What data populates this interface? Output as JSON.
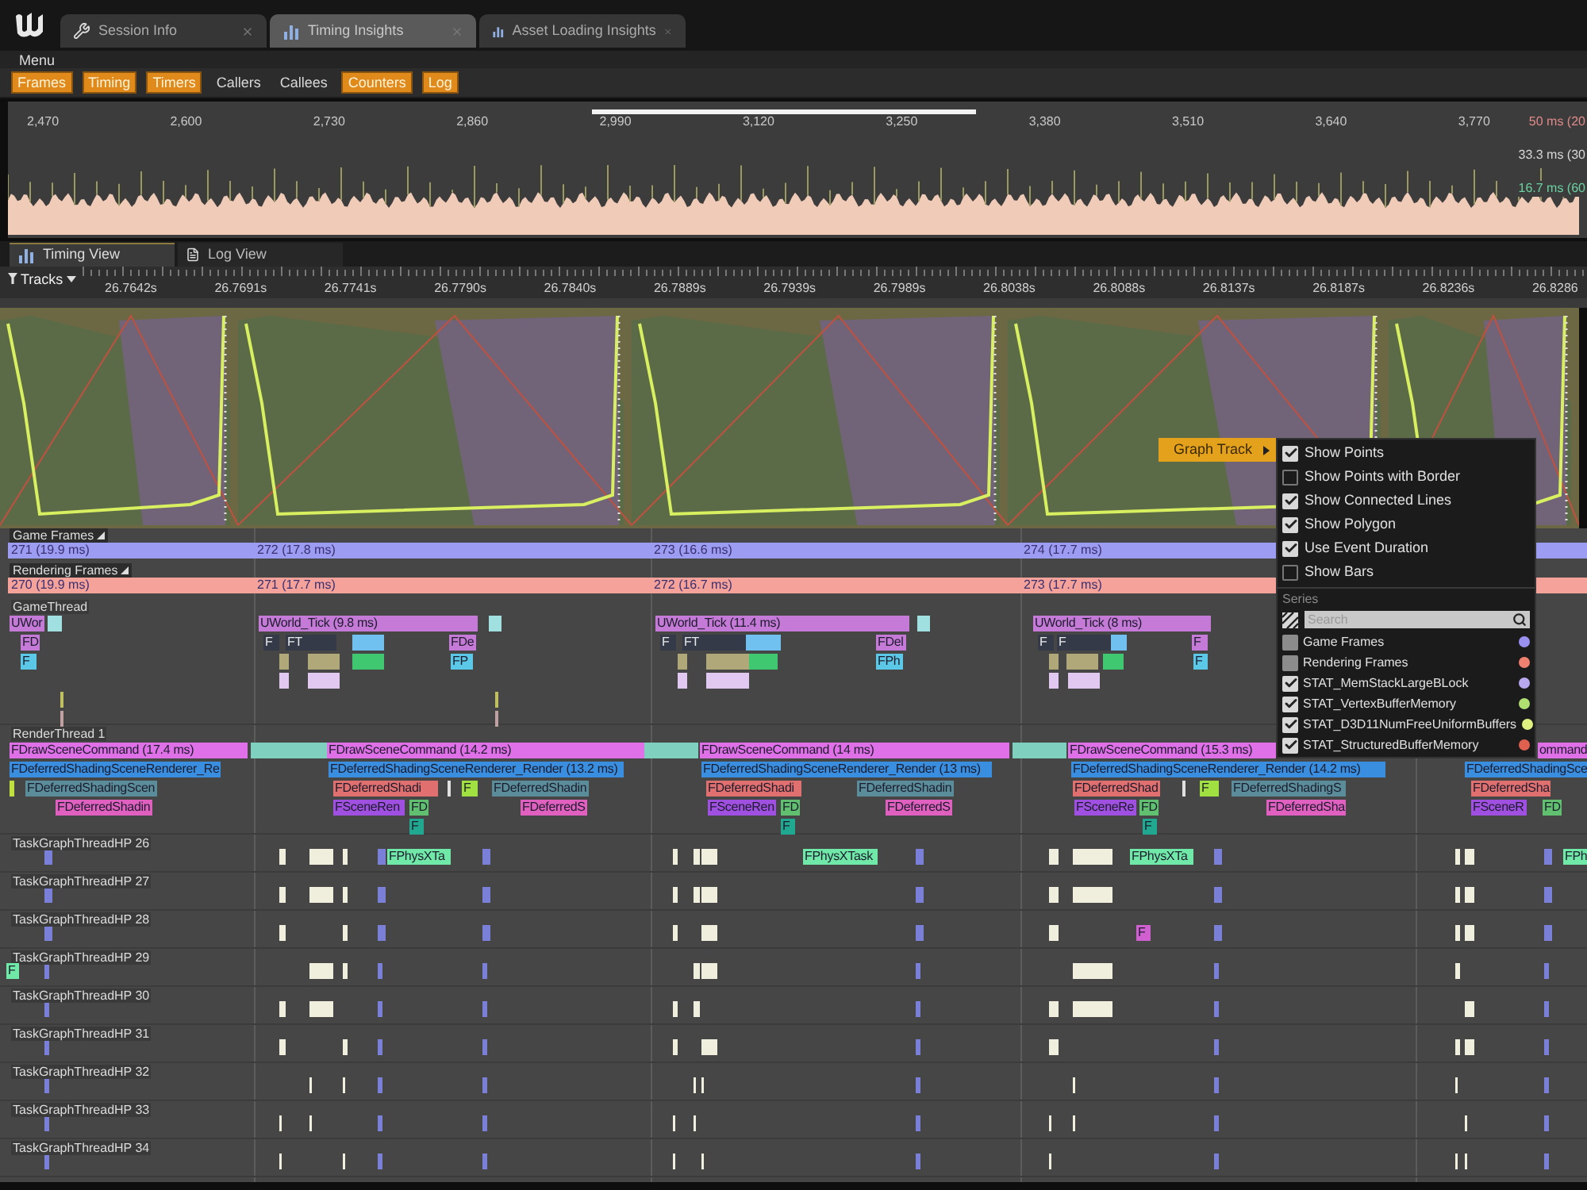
{
  "app_tabs": [
    {
      "label": "Session Info",
      "selected": false
    },
    {
      "label": "Timing Insights",
      "selected": true
    },
    {
      "label": "Asset Loading Insights",
      "selected": false
    }
  ],
  "menu_bar": [
    "Menu"
  ],
  "toolbar": [
    {
      "label": "Frames",
      "on": true
    },
    {
      "label": "Timing",
      "on": true
    },
    {
      "label": "Timers",
      "on": true
    },
    {
      "label": "Callers",
      "on": false
    },
    {
      "label": "Callees",
      "on": false
    },
    {
      "label": "Counters",
      "on": true
    },
    {
      "label": "Log",
      "on": true
    }
  ],
  "frames_panel": {
    "xticks": [
      "2,470",
      "2,600",
      "2,730",
      "2,860",
      "2,990",
      "3,120",
      "3,250",
      "3,380",
      "3,510",
      "3,640",
      "3,770"
    ],
    "thresholds": [
      {
        "label": "50 ms (20",
        "color": "#e08a8a"
      },
      {
        "label": "33.3 ms (30",
        "color": "#d8d8d8"
      },
      {
        "label": "16.7 ms (60",
        "color": "#6ad0a0"
      }
    ]
  },
  "view_tabs": [
    {
      "label": "Timing View",
      "selected": true
    },
    {
      "label": "Log View",
      "selected": false
    }
  ],
  "tracks_button": "Tracks",
  "time_ruler": [
    "26.7642s",
    "26.7691s",
    "26.7741s",
    "26.7790s",
    "26.7840s",
    "26.7889s",
    "26.7939s",
    "26.7989s",
    "26.8038s",
    "26.8088s",
    "26.8137s",
    "26.8187s",
    "26.8236s",
    "26.8286"
  ],
  "frame_tracks": [
    {
      "name": "Game Frames",
      "color": "#9c9cf2",
      "frames": [
        "271 (19.9 ms)",
        "272 (17.8 ms)",
        "273 (16.6 ms)",
        "274 (17.7 ms)"
      ]
    },
    {
      "name": "Rendering Frames",
      "color": "#f4a29a",
      "frames": [
        "270 (19.9 ms)",
        "271 (17.7 ms)",
        "272 (16.7 ms)",
        "273 (17.7 ms)"
      ]
    }
  ],
  "timeline_tracks": [
    {
      "name": "GameThread",
      "events": [
        {
          "label": "UWor",
          "color": "#c47ad6"
        },
        {
          "label": "UWorld_Tick (9.8 ms)",
          "color": "#c47ad6"
        },
        {
          "label": "UWorld_Tick (11.4 ms)",
          "color": "#c47ad6"
        },
        {
          "label": "UWorld_Tick (8 ms)",
          "color": "#c47ad6"
        },
        {
          "label": "FD",
          "color": "#c47ad6"
        },
        {
          "label": "F",
          "color": "#343a48"
        },
        {
          "label": "FT",
          "color": "#343a48"
        },
        {
          "label": "FDe",
          "color": "#c47ad6"
        },
        {
          "label": "F",
          "color": "#343a48"
        },
        {
          "label": "FT",
          "color": "#343a48"
        },
        {
          "label": "FDel",
          "color": "#c47ad6"
        },
        {
          "label": "F",
          "color": "#343a48"
        },
        {
          "label": "F",
          "color": "#343a48"
        },
        {
          "label": "F",
          "color": "#c47ad6"
        },
        {
          "label": "F",
          "color": "#5cc8e8"
        },
        {
          "label": "FP",
          "color": "#5cc8e8"
        },
        {
          "label": "FPh",
          "color": "#5cc8e8"
        },
        {
          "label": "F",
          "color": "#5cc8e8"
        }
      ]
    },
    {
      "name": "RenderThread 1",
      "events": [
        {
          "label": "FDrawSceneCommand (17.4 ms)",
          "color": "#e070e8"
        },
        {
          "label": "FDrawSceneCommand (14.2 ms)",
          "color": "#e070e8"
        },
        {
          "label": "FDrawSceneCommand (14 ms)",
          "color": "#e070e8"
        },
        {
          "label": "FDrawSceneCommand (15.3 ms)",
          "color": "#e070e8"
        },
        {
          "label": "ommand",
          "color": "#e070e8"
        },
        {
          "label": "FDeferredShadingSceneRenderer_Re",
          "color": "#3a8ee0"
        },
        {
          "label": "FDeferredShadingSceneRenderer_Render (13.2 ms)",
          "color": "#3a8ee0"
        },
        {
          "label": "FDeferredShadingSceneRenderer_Render (13 ms)",
          "color": "#3a8ee0"
        },
        {
          "label": "FDeferredShadingSceneRenderer_Render (14.2 ms)",
          "color": "#3a8ee0"
        },
        {
          "label": "FDeferredShadingSce",
          "color": "#3a8ee0"
        },
        {
          "label": "FDeferredShadingScen",
          "color": "#5a8c9a"
        },
        {
          "label": "FDeferredShadi",
          "color": "#e07070"
        },
        {
          "label": "F",
          "color": "#a0e040"
        },
        {
          "label": "FDeferredShadin",
          "color": "#5a8c9a"
        },
        {
          "label": "FDeferredShadi",
          "color": "#e07070"
        },
        {
          "label": "FDeferredShadin",
          "color": "#5a8c9a"
        },
        {
          "label": "FDeferredShad",
          "color": "#e07070"
        },
        {
          "label": "F",
          "color": "#a0e040"
        },
        {
          "label": "FDeferredShadingS",
          "color": "#5a8c9a"
        },
        {
          "label": "FDeferredSha",
          "color": "#e07070"
        },
        {
          "label": "FDeferredShadin",
          "color": "#e060c0"
        },
        {
          "label": "FSceneRen",
          "color": "#a050e0"
        },
        {
          "label": "FD",
          "color": "#60c070"
        },
        {
          "label": "FDeferredS",
          "color": "#e060c0"
        },
        {
          "label": "FSceneRen",
          "color": "#a050e0"
        },
        {
          "label": "FD",
          "color": "#60c070"
        },
        {
          "label": "FDeferredS",
          "color": "#e060c0"
        },
        {
          "label": "FSceneRe",
          "color": "#a050e0"
        },
        {
          "label": "FD",
          "color": "#60c070"
        },
        {
          "label": "FDeferredSha",
          "color": "#e060c0"
        },
        {
          "label": "FSceneR",
          "color": "#a050e0"
        },
        {
          "label": "FD",
          "color": "#60c070"
        },
        {
          "label": "F",
          "color": "#20a890"
        },
        {
          "label": "F",
          "color": "#20a890"
        },
        {
          "label": "F",
          "color": "#20a890"
        }
      ]
    },
    {
      "name": "TaskGraphThreadHP 26",
      "events": [
        {
          "label": "FPhysXTa",
          "color": "#70e8a8"
        },
        {
          "label": "FPhysXTask",
          "color": "#70e8a8"
        },
        {
          "label": "FPhysXTa",
          "color": "#70e8a8"
        },
        {
          "label": "FPh",
          "color": "#70e8a8"
        }
      ]
    },
    {
      "name": "TaskGraphThreadHP 27"
    },
    {
      "name": "TaskGraphThreadHP 28",
      "events": [
        {
          "label": "F",
          "color": "#d060d0"
        }
      ]
    },
    {
      "name": "TaskGraphThreadHP 29",
      "events": [
        {
          "label": "F",
          "color": "#70e8a8"
        }
      ]
    },
    {
      "name": "TaskGraphThreadHP 30"
    },
    {
      "name": "TaskGraphThreadHP 31"
    },
    {
      "name": "TaskGraphThreadHP 32"
    },
    {
      "name": "TaskGraphThreadHP 33"
    },
    {
      "name": "TaskGraphThreadHP 34"
    }
  ],
  "context_menu": {
    "button": "Graph Track",
    "options": [
      {
        "label": "Show Points",
        "checked": true
      },
      {
        "label": "Show Points with Border",
        "checked": false
      },
      {
        "label": "Show Connected Lines",
        "checked": true
      },
      {
        "label": "Show Polygon",
        "checked": true
      },
      {
        "label": "Use Event Duration",
        "checked": true
      },
      {
        "label": "Show Bars",
        "checked": false
      }
    ],
    "series_heading": "Series",
    "search": {
      "placeholder": "Search"
    },
    "series": [
      {
        "label": "Game Frames",
        "checked": false,
        "color": "#9a90f0"
      },
      {
        "label": "Rendering Frames",
        "checked": false,
        "color": "#f08070"
      },
      {
        "label": "STAT_MemStackLargeBLock",
        "checked": true,
        "color": "#b8a8f0"
      },
      {
        "label": "STAT_VertexBufferMemory",
        "checked": true,
        "color": "#b0e070"
      },
      {
        "label": "STAT_D3D11NumFreeUniformBuffers",
        "checked": true,
        "color": "#e0f080"
      },
      {
        "label": "STAT_StructuredBufferMemory",
        "checked": true,
        "color": "#e06050"
      }
    ]
  }
}
